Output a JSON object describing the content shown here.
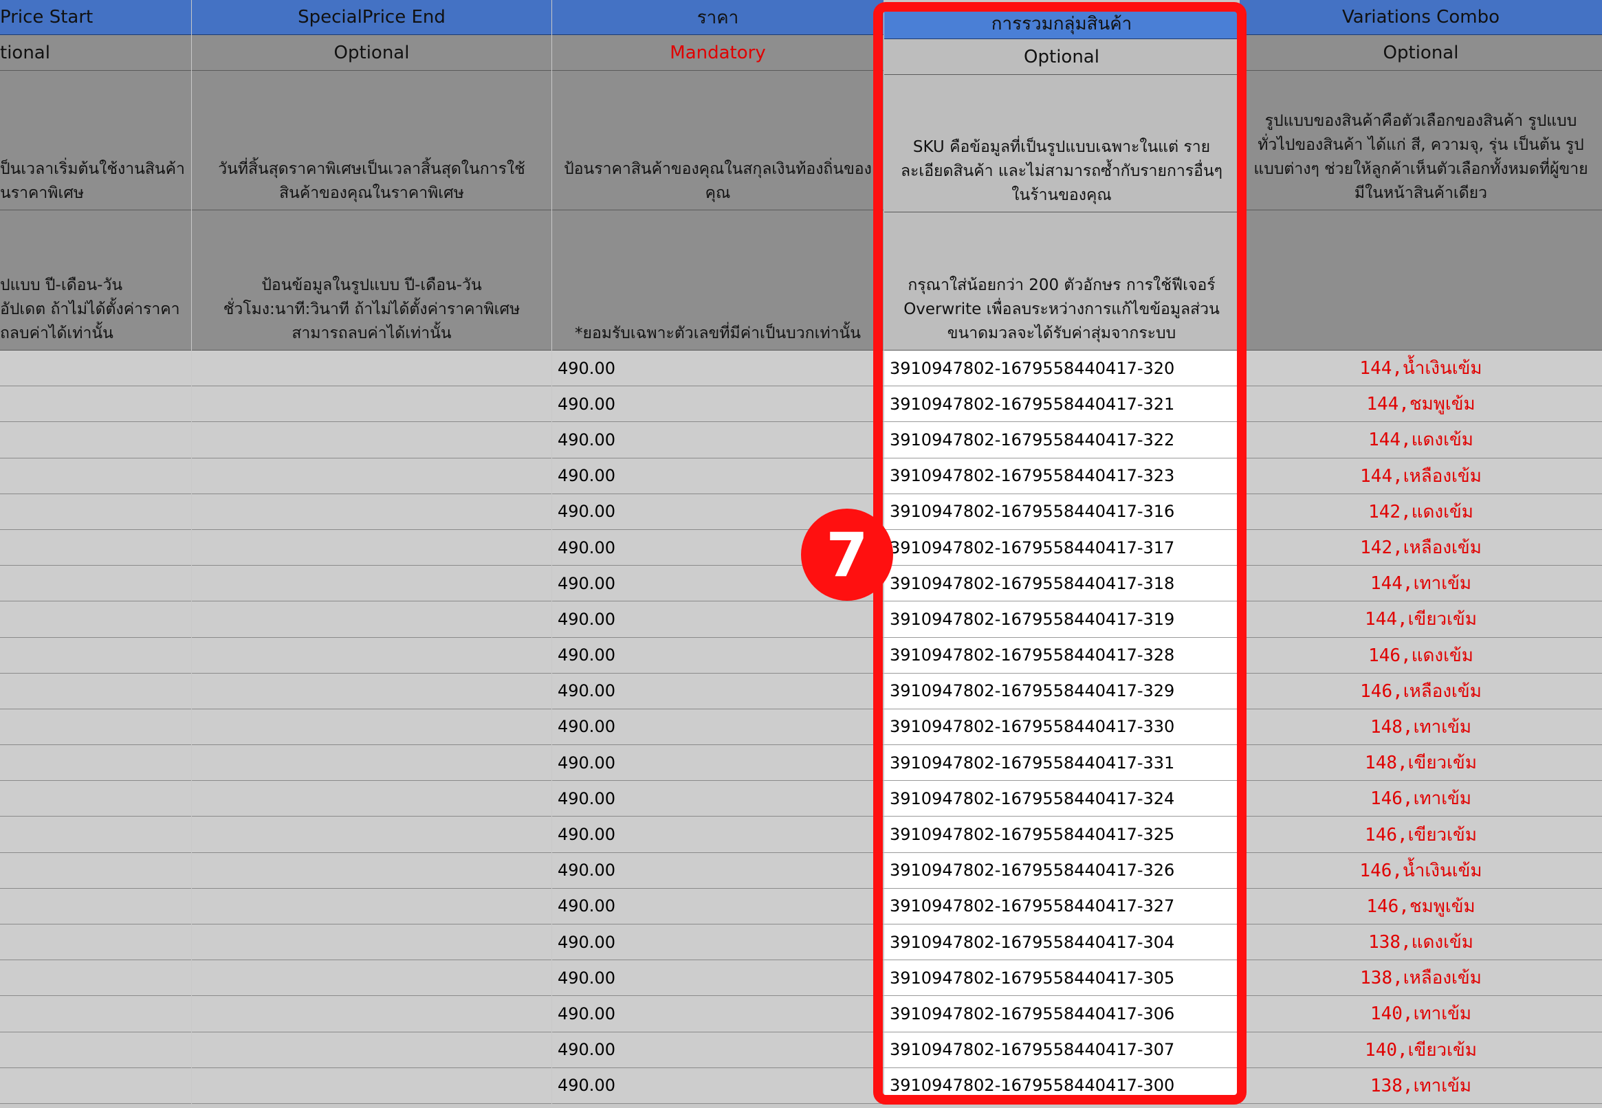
{
  "columns": {
    "special_start": {
      "header": "Price Start",
      "requirement": "tional",
      "description": "ป็นเวลาเริ่มต้นใช้งานสินค้า\nนราคาพิเศษ",
      "note": "ปแบบ ปี-เดือน-วัน\nอัปเดต ถ้าไม่ได้ตั้งค่าราคา\nถลบค่าได้เท่านั้น"
    },
    "special_end": {
      "header": "SpecialPrice End",
      "requirement": "Optional",
      "description": "วันที่สิ้นสุดราคาพิเศษเป็นเวลาสิ้นสุดในการใช้\nสินค้าของคุณในราคาพิเศษ",
      "note": "ป้อนข้อมูลในรูปแบบ ปี-เดือน-วัน\nชั่วโมง:นาที:วินาที ถ้าไม่ได้ตั้งค่าราคาพิเศษ\nสามารถลบค่าได้เท่านั้น"
    },
    "price": {
      "header": "ราคา",
      "requirement": "Mandatory",
      "description": "ป้อนราคาสินค้าของคุณในสกุลเงินท้องถิ่นของ\nคุณ",
      "note": "*ยอมรับเฉพาะตัวเลขที่มีค่าเป็นบวกเท่านั้น"
    },
    "sku": {
      "header": "การรวมกลุ่มสินค้า",
      "requirement": "Optional",
      "description": "SKU คือข้อมูลที่เป็นรูปแบบเฉพาะในแต่ ราย\nละเอียดสินค้า และไม่สามารถซ้ำกับรายการอื่นๆ\nในร้านของคุณ",
      "note": "กรุณาใส่น้อยกว่า 200 ตัวอักษร การใช้ฟีเจอร์\nOverwrite เพื่อลบระหว่างการแก้ไขข้อมูลส่วน\nขนาดมวลจะได้รับค่าสุ่มจากระบบ"
    },
    "variations": {
      "header": "Variations Combo",
      "requirement": "Optional",
      "description": "รูปแบบของสินค้าคือตัวเลือกของสินค้า รูปแบบ\nทั่วไปของสินค้า ได้แก่ สี, ความจุ, รุ่น เป็นต้น รูป\nแบบต่างๆ ช่วยให้ลูกค้าเห็นตัวเลือกทั้งหมดที่ผู้ขาย\nมีในหน้าสินค้าเดียว",
      "note": ""
    }
  },
  "rows": [
    {
      "price": "490.00",
      "sku": "3910947802-1679558440417-320",
      "variation": "144,น้ำเงินเข้ม"
    },
    {
      "price": "490.00",
      "sku": "3910947802-1679558440417-321",
      "variation": "144,ชมพูเข้ม"
    },
    {
      "price": "490.00",
      "sku": "3910947802-1679558440417-322",
      "variation": "144,แดงเข้ม"
    },
    {
      "price": "490.00",
      "sku": "3910947802-1679558440417-323",
      "variation": "144,เหลืองเข้ม"
    },
    {
      "price": "490.00",
      "sku": "3910947802-1679558440417-316",
      "variation": "142,แดงเข้ม"
    },
    {
      "price": "490.00",
      "sku": "3910947802-1679558440417-317",
      "variation": "142,เหลืองเข้ม"
    },
    {
      "price": "490.00",
      "sku": "3910947802-1679558440417-318",
      "variation": "144,เทาเข้ม"
    },
    {
      "price": "490.00",
      "sku": "3910947802-1679558440417-319",
      "variation": "144,เขียวเข้ม"
    },
    {
      "price": "490.00",
      "sku": "3910947802-1679558440417-328",
      "variation": "146,แดงเข้ม"
    },
    {
      "price": "490.00",
      "sku": "3910947802-1679558440417-329",
      "variation": "146,เหลืองเข้ม"
    },
    {
      "price": "490.00",
      "sku": "3910947802-1679558440417-330",
      "variation": "148,เทาเข้ม"
    },
    {
      "price": "490.00",
      "sku": "3910947802-1679558440417-331",
      "variation": "148,เขียวเข้ม"
    },
    {
      "price": "490.00",
      "sku": "3910947802-1679558440417-324",
      "variation": "146,เทาเข้ม"
    },
    {
      "price": "490.00",
      "sku": "3910947802-1679558440417-325",
      "variation": "146,เขียวเข้ม"
    },
    {
      "price": "490.00",
      "sku": "3910947802-1679558440417-326",
      "variation": "146,น้ำเงินเข้ม"
    },
    {
      "price": "490.00",
      "sku": "3910947802-1679558440417-327",
      "variation": "146,ชมพูเข้ม"
    },
    {
      "price": "490.00",
      "sku": "3910947802-1679558440417-304",
      "variation": "138,แดงเข้ม"
    },
    {
      "price": "490.00",
      "sku": "3910947802-1679558440417-305",
      "variation": "138,เหลืองเข้ม"
    },
    {
      "price": "490.00",
      "sku": "3910947802-1679558440417-306",
      "variation": "140,เทาเข้ม"
    },
    {
      "price": "490.00",
      "sku": "3910947802-1679558440417-307",
      "variation": "140,เขียวเข้ม"
    },
    {
      "price": "490.00",
      "sku": "3910947802-1679558440417-300",
      "variation": "138,เทาเข้ม"
    }
  ],
  "annotation": {
    "step_number": "7",
    "highlight_color": "#ff1010"
  },
  "colors": {
    "header_blue": "#4472c4",
    "mandatory_red": "#e00000",
    "variation_text_red": "#e00000"
  }
}
